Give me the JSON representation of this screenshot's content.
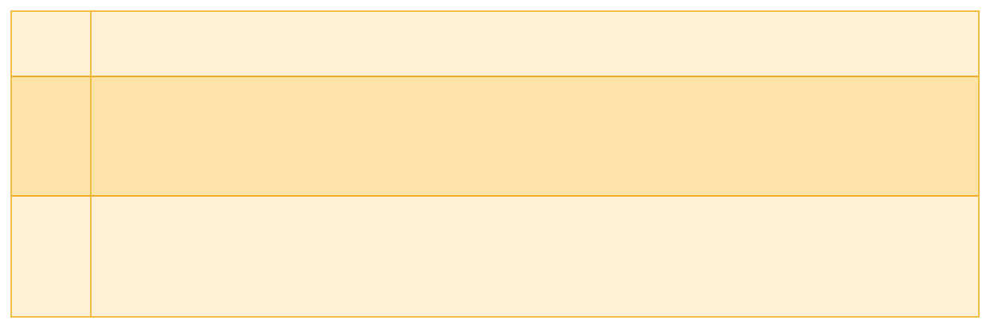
{
  "table": {
    "rows": [
      {
        "label": "",
        "content": ""
      },
      {
        "label": "",
        "content": ""
      },
      {
        "label": "",
        "content": ""
      }
    ],
    "colors": {
      "border": "#f2bd45",
      "row_divider": "#eeaa2a",
      "light_fill": "#fef1d5",
      "highlight_fill": "#fde3a8"
    }
  }
}
